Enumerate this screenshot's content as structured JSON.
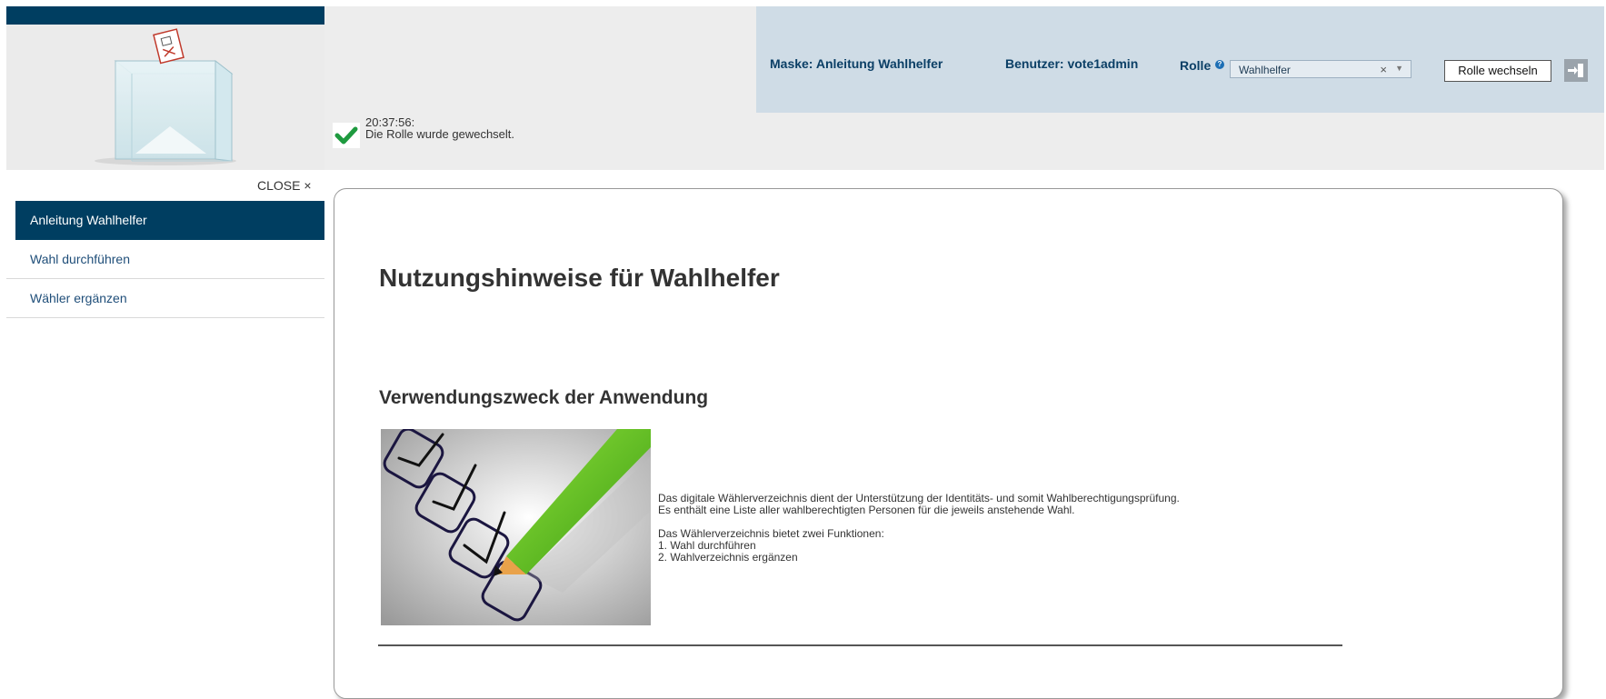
{
  "header": {
    "mask_label": "Maske: Anleitung Wahlhelfer",
    "user_label": "Benutzer: vote1admin",
    "role_label": "Rolle",
    "role_value": "Wahlhelfer",
    "switch_role_button": "Rolle wechseln"
  },
  "message": {
    "time": "20:37:56:",
    "text": "Die Rolle wurde gewechselt."
  },
  "sidebar": {
    "close_label": "CLOSE ×",
    "items": [
      {
        "label": "Anleitung Wahlhelfer",
        "active": true
      },
      {
        "label": "Wahl durchführen",
        "active": false
      },
      {
        "label": "Wähler ergänzen",
        "active": false
      }
    ]
  },
  "content": {
    "title": "Nutzungshinweise für Wahlhelfer",
    "section_title": "Verwendungszweck der Anwendung",
    "paragraph_1_line_1": "Das digitale Wählerverzeichnis dient der Unterstützung der Identitäts- und somit Wahlberechtigungsprüfung.",
    "paragraph_1_line_2": "Es enthält eine Liste aller wahlberechtigten Personen für die jeweils anstehende Wahl.",
    "paragraph_2_intro": "Das Wählerverzeichnis bietet zwei Funktionen:",
    "paragraph_2_item_1": "1. Wahl durchführen",
    "paragraph_2_item_2": "2. Wahlverzeichnis ergänzen"
  },
  "colors": {
    "brand_dark": "#003e61",
    "header_info_bg": "#cfdce6",
    "success_green": "#1e9a3f"
  },
  "icons": [
    "ballot-box-logo",
    "checkmark-icon",
    "help-icon",
    "clear-icon",
    "caret-down-icon",
    "logout-icon",
    "checklist-illustration"
  ]
}
